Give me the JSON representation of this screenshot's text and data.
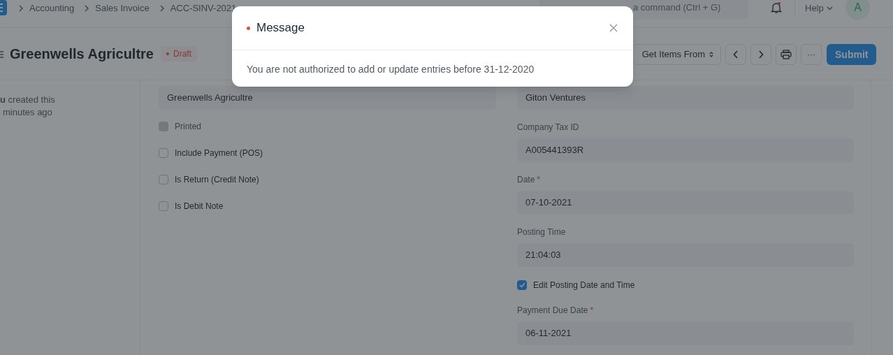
{
  "navbar": {
    "breadcrumbs": [
      "Accounting",
      "Sales Invoice",
      "ACC-SINV-2021"
    ],
    "search_placeholder": "a command (Ctrl + G)",
    "notification_unread": true,
    "help": "Help",
    "avatar": "A"
  },
  "page": {
    "title": "Greenwells Agricultre",
    "status": "Draft",
    "get_items": "Get Items From",
    "more": "···",
    "submit": "Submit"
  },
  "activity": {
    "text": "**u** created this",
    "time": "minutes ago"
  },
  "form": {
    "left": [
      {
        "kind": "field",
        "value": "Greenwells Agricultre"
      },
      {
        "kind": "checkbox",
        "label": "Printed",
        "checked": false,
        "disabled": true
      },
      {
        "kind": "checkbox",
        "label": "Include Payment (POS)",
        "checked": false,
        "disabled": false
      },
      {
        "kind": "checkbox",
        "label": "Is Return (Credit Note)",
        "checked": false,
        "disabled": false
      },
      {
        "kind": "checkbox",
        "label": "Is Debit Note",
        "checked": false,
        "disabled": false
      }
    ],
    "right": [
      {
        "kind": "field",
        "value": "Giton Ventures"
      },
      {
        "kind": "field",
        "label": "Company Tax ID",
        "value": "A005441393R"
      },
      {
        "kind": "field",
        "label": "Date",
        "required_mark": "*",
        "value": "07-10-2021"
      },
      {
        "kind": "field",
        "label": "Posting Time",
        "value": "21:04:03"
      },
      {
        "kind": "checkbox",
        "label": "Edit Posting Date and Time",
        "checked": true
      },
      {
        "kind": "field",
        "label": "Payment Due Date",
        "required_mark": "*",
        "value": "06-11-2021"
      }
    ]
  },
  "modal": {
    "title": "Message",
    "message": "You are not authorized to add or update entries before 31-12-2020"
  }
}
